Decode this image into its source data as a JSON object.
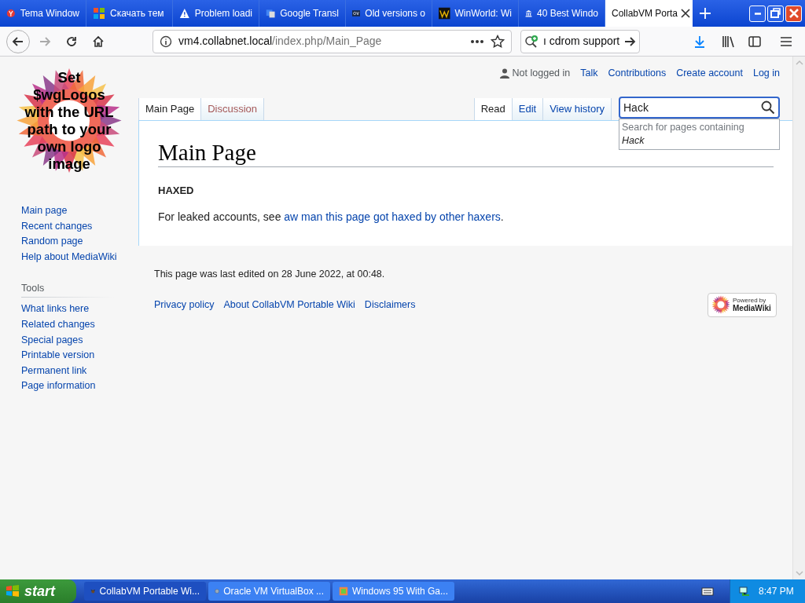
{
  "browser": {
    "tabs": [
      {
        "title": "Tema Window",
        "selected": false
      },
      {
        "title": "Скачать тем",
        "selected": false
      },
      {
        "title": "Problem loadi",
        "selected": false
      },
      {
        "title": "Google Transl",
        "selected": false
      },
      {
        "title": "Old versions o",
        "selected": false
      },
      {
        "title": "WinWorld: Wi",
        "selected": false
      },
      {
        "title": "40 Best Windo",
        "selected": false
      },
      {
        "title": "CollabVM Porta",
        "selected": true
      }
    ],
    "url": {
      "host": "vm4.collabnet.local",
      "path": "/index.php/Main_Page"
    },
    "search": {
      "value": "ı cdrom support"
    }
  },
  "wiki": {
    "logo_text": "Set $wgLogos with the URL path to your own logo image",
    "personal": [
      {
        "label": "Not logged in",
        "kind": "status"
      },
      {
        "label": "Talk",
        "kind": "link"
      },
      {
        "label": "Contributions",
        "kind": "link"
      },
      {
        "label": "Create account",
        "kind": "link"
      },
      {
        "label": "Log in",
        "kind": "link"
      }
    ],
    "namespace_tabs": [
      {
        "label": "Main Page",
        "selected": true
      },
      {
        "label": "Discussion",
        "selected": false
      }
    ],
    "view_tabs": [
      {
        "label": "Read",
        "selected": true
      },
      {
        "label": "Edit",
        "selected": false
      },
      {
        "label": "View history",
        "selected": false
      }
    ],
    "search": {
      "value": "Hack",
      "suggestion": "Search for pages containing",
      "suggestion_term": "Hack"
    },
    "title": "Main Page",
    "section_heading": "HAXED",
    "paragraph": {
      "before": "For leaked accounts, see ",
      "link": "aw man this page got haxed by other haxers",
      "after": "."
    },
    "navigation": [
      "Main page",
      "Recent changes",
      "Random page",
      "Help about MediaWiki"
    ],
    "tools": {
      "heading": "Tools",
      "items": [
        "What links here",
        "Related changes",
        "Special pages",
        "Printable version",
        "Permanent link",
        "Page information"
      ]
    },
    "footer": {
      "last_edited": "This page was last edited on 28 June 2022, at 00:48.",
      "links": [
        "Privacy policy",
        "About CollabVM Portable Wiki",
        "Disclaimers"
      ],
      "powered_by": {
        "line1": "Powered by",
        "line2": "MediaWiki"
      }
    }
  },
  "taskbar": {
    "start": "start",
    "tasks": [
      "CollabVM Portable Wi...",
      "Oracle VM VirtualBox ...",
      "Windows 95 With Ga..."
    ],
    "clock": "8:47 PM"
  }
}
